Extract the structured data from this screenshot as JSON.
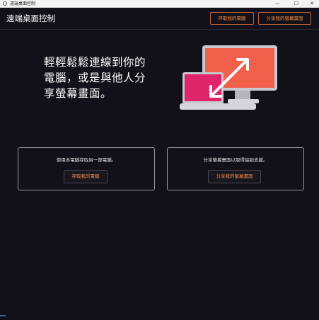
{
  "window": {
    "title": "遠端桌面控制",
    "minimize_glyph": "—",
    "maximize_glyph": "☐",
    "close_glyph": "✕"
  },
  "header": {
    "title": "遠端桌面控制",
    "access_button": "存取我的電腦",
    "share_button": "分享我的螢幕畫面"
  },
  "hero": {
    "text": "輕輕鬆鬆連線到你的電腦，或是與他人分享螢幕畫面。",
    "illustration_icon": "monitors-connect-icon"
  },
  "cards": [
    {
      "text": "使用本電腦存取另一部電腦。",
      "button": "存取我的電腦"
    },
    {
      "text": "分享螢幕畫面以取得協助支援。",
      "button": "分享我的螢幕畫面"
    }
  ],
  "colors": {
    "background": "#121018",
    "accent": "#f28c4a",
    "monitor_front": "#f0604a",
    "monitor_back": "#e0256a"
  }
}
